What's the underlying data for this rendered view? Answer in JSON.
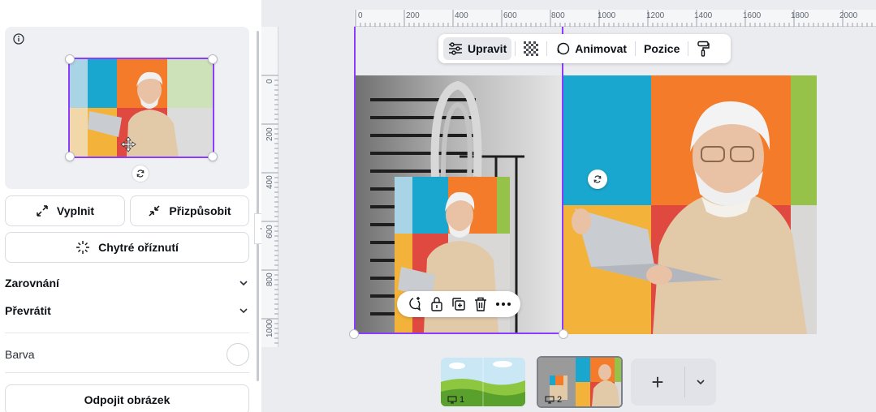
{
  "left_panel": {
    "fill_label": "Vyplnit",
    "fit_label": "Přizpůsobit",
    "smart_crop_label": "Chytré oříznutí",
    "align_label": "Zarovnání",
    "flip_label": "Převrátit",
    "color_label": "Barva",
    "detach_label": "Odpojit obrázek"
  },
  "toolbar": {
    "edit_label": "Upravit",
    "animate_label": "Animovat",
    "position_label": "Pozice"
  },
  "ruler": {
    "horizontal_ticks": [
      "0",
      "200",
      "400",
      "600",
      "800",
      "1000",
      "1200",
      "1400",
      "1600",
      "1800",
      "2000"
    ],
    "vertical_ticks": [
      "0",
      "200",
      "400",
      "600",
      "800",
      "1000"
    ]
  },
  "pages": [
    {
      "number": "1"
    },
    {
      "number": "2"
    }
  ],
  "add_page": {
    "plus": "+"
  },
  "colors": {
    "accent": "#8b3dff",
    "tile_blue": "#1aa7cf",
    "tile_orange": "#f47b2a",
    "tile_green": "#97c24a",
    "tile_yellow": "#f3b33a",
    "tile_red": "#e0493f",
    "tile_grey": "#d9d8d6"
  }
}
